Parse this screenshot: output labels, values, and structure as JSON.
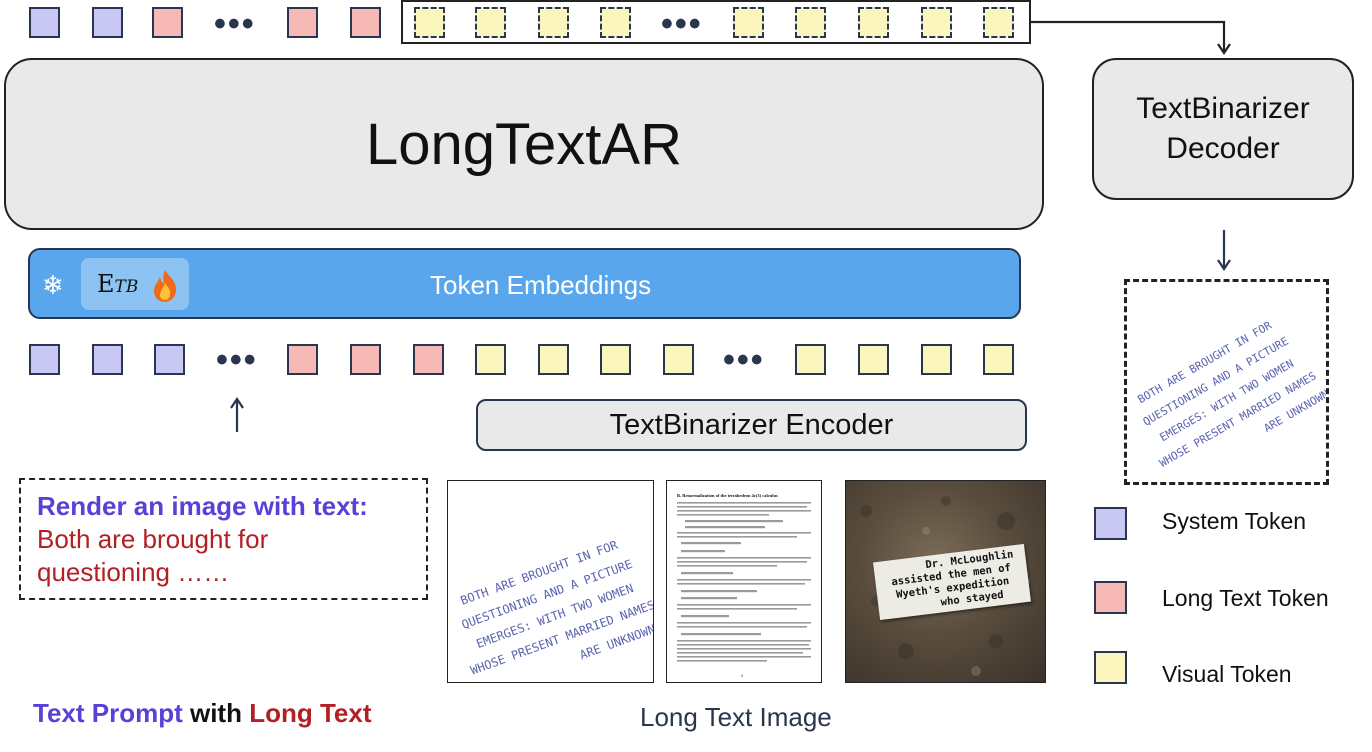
{
  "top_sequence": {
    "tokens_left": [
      "system",
      "system",
      "long",
      "long",
      "long"
    ],
    "tokens_right": [
      "visual",
      "visual",
      "visual",
      "visual",
      "visual",
      "visual",
      "visual",
      "visual",
      "visual"
    ],
    "ellipsis": "•••"
  },
  "main_model": {
    "title": "LongTextAR"
  },
  "decoder": {
    "line1": "TextBinarizer",
    "line2": "Decoder"
  },
  "embedding": {
    "label": "Token Embeddings",
    "frozen_icon": "snowflake-icon",
    "trainable_icon": "flame-icon",
    "etb_base": "E",
    "etb_sub": "TB",
    "snowflake_glyph": "❄"
  },
  "bottom_sequence": {
    "tokens": [
      "system",
      "system",
      "system",
      "long",
      "long",
      "long",
      "visual",
      "visual",
      "visual",
      "visual",
      "visual",
      "visual",
      "visual",
      "visual",
      "visual"
    ],
    "ellipsis": "•••"
  },
  "encoder": {
    "label": "TextBinarizer Encoder"
  },
  "prompt": {
    "lead": "Render an image with text:",
    "line1": "Both are brought for",
    "line2": "questioning ……"
  },
  "captions": {
    "prompt_part1": "Text Prompt",
    "prompt_part2": " with ",
    "prompt_part3": "Long Text",
    "image": "Long Text Image"
  },
  "handwritten_text": {
    "lines": [
      "BOTH ARE BROUGHT IN FOR",
      "QUESTIONING AND A PICTURE",
      "EMERGES: WITH TWO WOMEN",
      "WHOSE PRESENT MARRIED NAMES",
      "ARE UNKNOWN"
    ]
  },
  "document_image": {
    "heading": "B.   Renormalization of the tetrahedron 4ε(3) calculus",
    "page_number": "8"
  },
  "photo_image": {
    "note_lines": [
      "Dr. McLoughlin",
      "assisted the men of",
      "Wyeth's expedition",
      "who stayed"
    ]
  },
  "legend": [
    {
      "label": "System Token",
      "color": "#c9c8f5"
    },
    {
      "label": "Long Text Token",
      "color": "#f6b9b6"
    },
    {
      "label": "Visual Token",
      "color": "#fbf6bd"
    }
  ],
  "colors": {
    "system_token": "#c9c8f5",
    "long_text_token": "#f6b9b6",
    "visual_token": "#fbf6bd",
    "embedding_bar": "#5aa6ec",
    "prompt_accent": "#5b3fd6",
    "long_text_accent": "#b21f24"
  }
}
